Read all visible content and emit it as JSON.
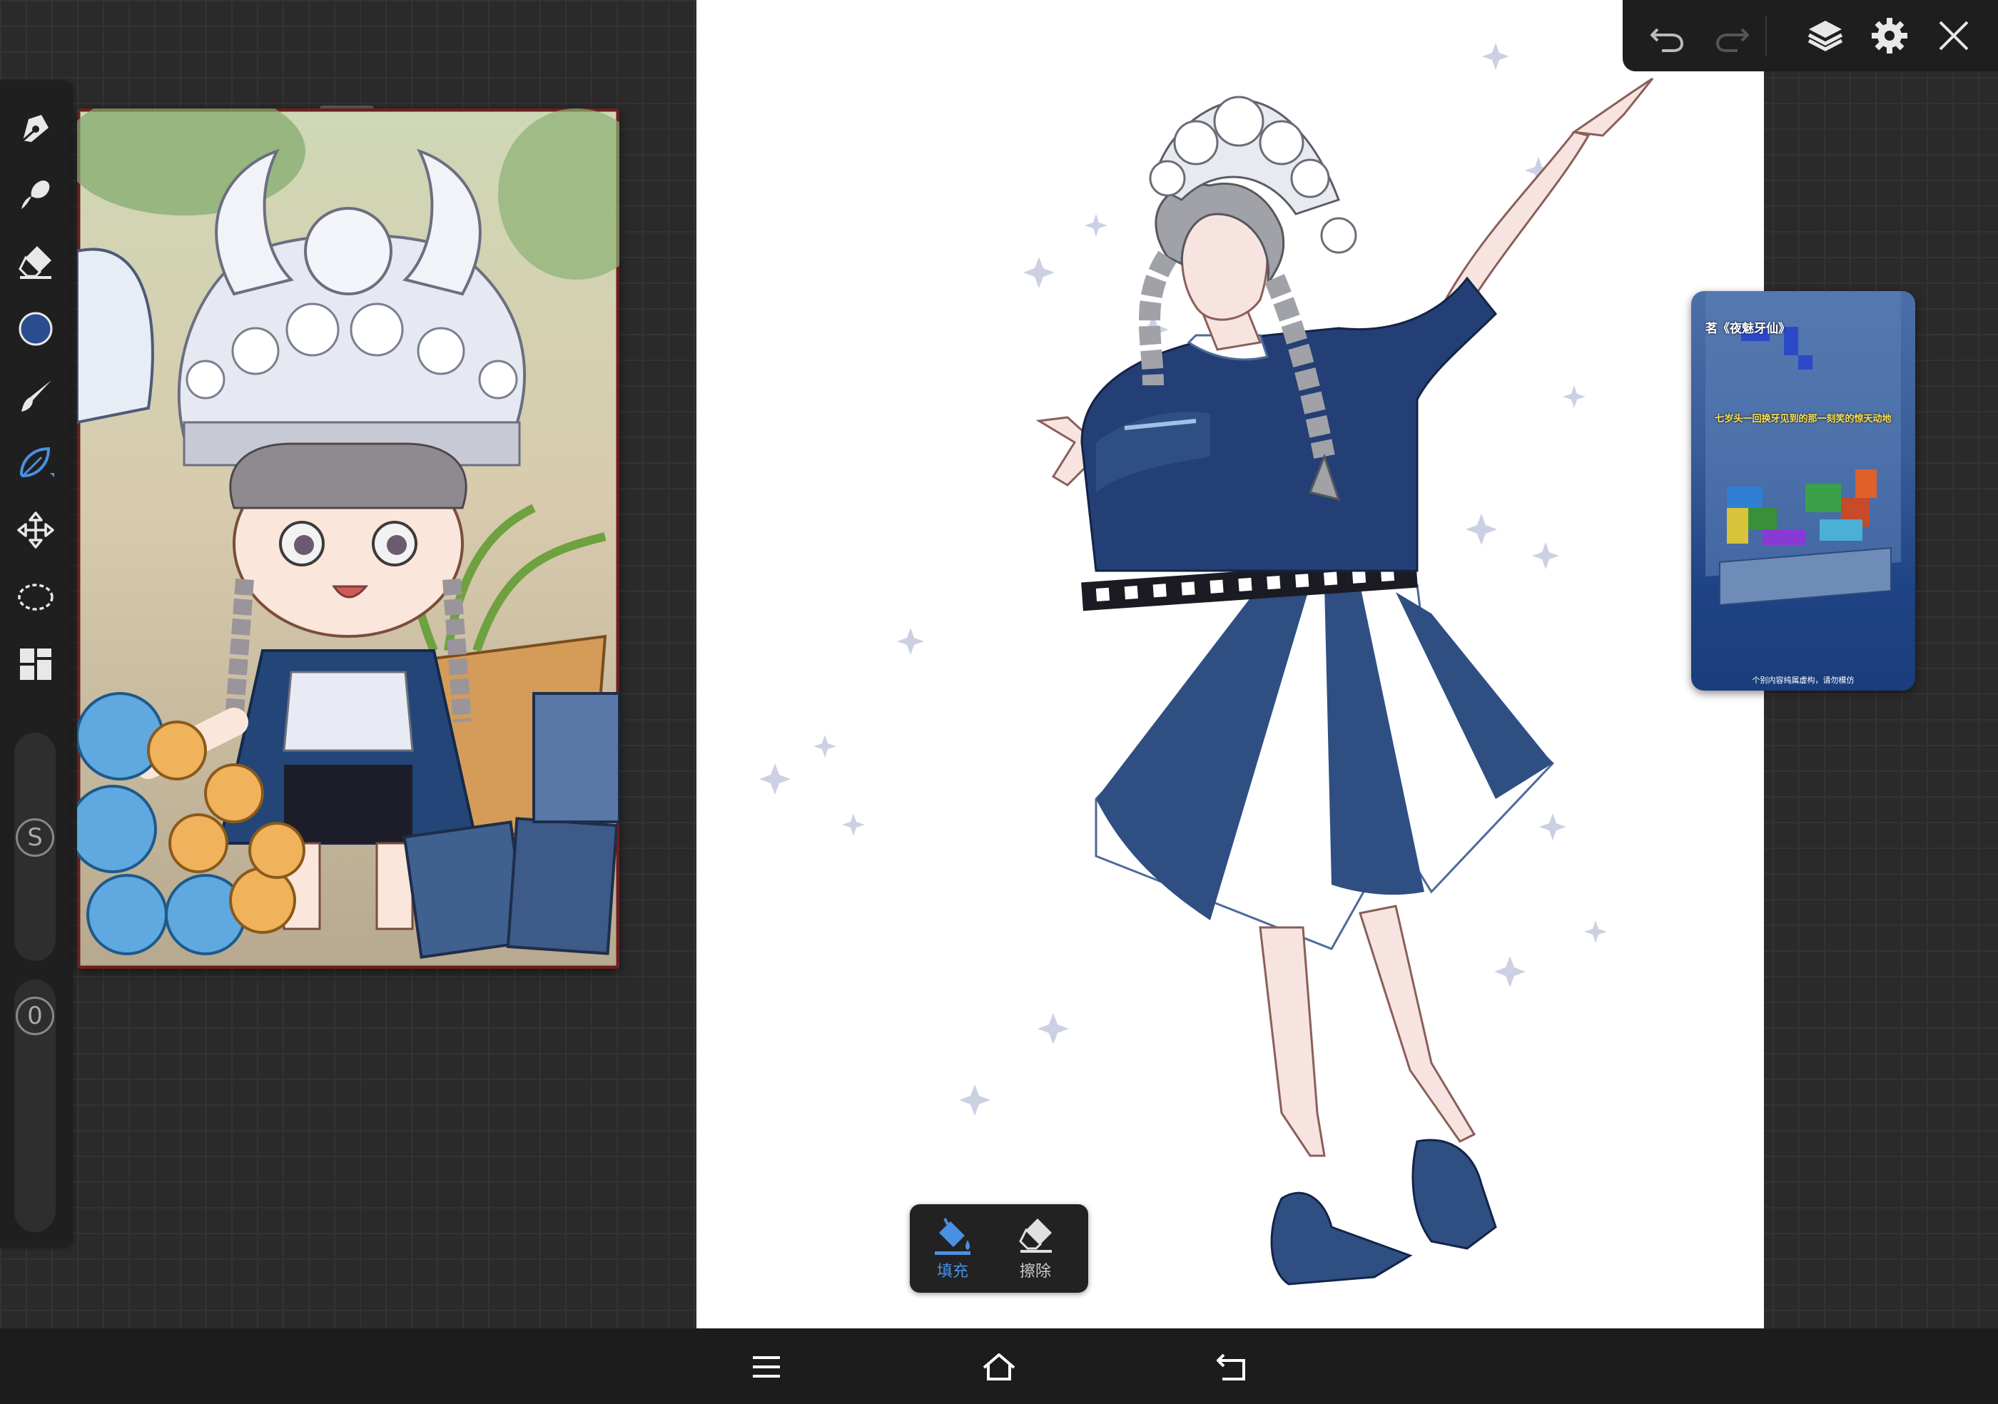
{
  "app": {
    "accent": "#4a90e2",
    "current_color": "#2a4d8f"
  },
  "left_toolbar": {
    "tools": [
      {
        "name": "pen-tool",
        "icon": "pen-icon"
      },
      {
        "name": "smudge-tool",
        "icon": "smudge-icon"
      },
      {
        "name": "eraser-tool",
        "icon": "eraser-icon"
      },
      {
        "name": "color-swatch",
        "icon": "color-circle"
      },
      {
        "name": "brush-tool",
        "icon": "brush-icon"
      },
      {
        "name": "fill-tool",
        "icon": "fill-leaf-icon",
        "active": true
      },
      {
        "name": "transform-tool",
        "icon": "move-arrows-icon"
      },
      {
        "name": "lasso-tool",
        "icon": "lasso-icon"
      },
      {
        "name": "layer-grid-tool",
        "icon": "grid-icon"
      }
    ],
    "size_slider_label": "S",
    "opacity_slider_label": "0"
  },
  "top_toolbar": {
    "buttons": [
      "undo-icon",
      "redo-icon",
      "layers-icon",
      "gear-icon",
      "close-icon"
    ]
  },
  "video_panel": {
    "title": "茗《夜魅牙仙》",
    "subtitle": "七岁头一回换牙见到的那一刻笑的惊天动地",
    "caption": "个别内容纯属虚构，请勿模仿"
  },
  "fill_toolbar": {
    "fill_label": "填充",
    "erase_label": "擦除",
    "fill_color": "#4a90e2",
    "erase_color": "#cccccc"
  },
  "nav_bar": {
    "buttons": [
      "menu-icon",
      "home-icon",
      "back-icon"
    ]
  }
}
